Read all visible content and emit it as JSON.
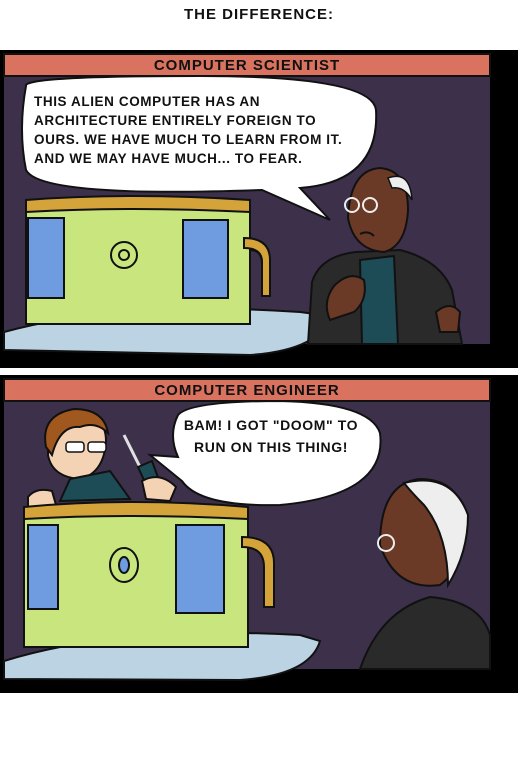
{
  "title": "THE DIFFERENCE:",
  "panels": [
    {
      "caption": "COMPUTER SCIENTIST",
      "speech": "THIS ALIEN COMPUTER HAS AN ARCHITECTURE ENTIRELY FOREIGN TO OURS. WE HAVE MUCH TO LEARN FROM IT. AND WE MAY HAVE MUCH... TO FEAR."
    },
    {
      "caption": "COMPUTER ENGINEER",
      "speech": "BAM! I GOT \"DOOM\" TO RUN ON THIS THING!"
    }
  ],
  "colors": {
    "caption_bar": "#d9735f",
    "background": "#3d304a",
    "machine_body": "#c9e67e",
    "machine_trim": "#d4a43a",
    "machine_screen": "#6f9be0",
    "table": "#bcd3e3",
    "skin_dark": "#6b3a26",
    "skin_light": "#f4d3b5",
    "hair": "#a0581e",
    "shirt_teal": "#1d4c56",
    "jacket": "#2a2a2a"
  }
}
